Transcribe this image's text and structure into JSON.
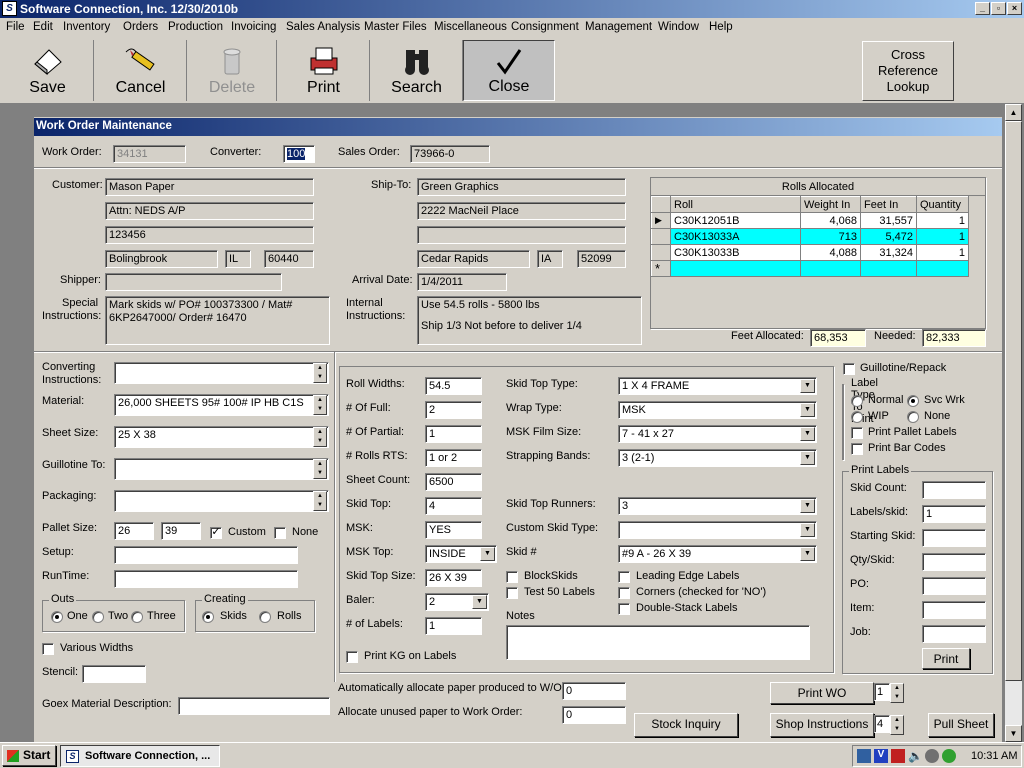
{
  "window": {
    "title": "Software Connection, Inc.    12/30/2010b"
  },
  "menu": [
    "File",
    "Edit",
    "Inventory",
    "Orders",
    "Production",
    "Invoicing",
    "Sales Analysis",
    "Master Files",
    "Miscellaneous",
    "Consignment",
    "Management",
    "Window",
    "Help"
  ],
  "toolbar": {
    "save": "Save",
    "cancel": "Cancel",
    "delete": "Delete",
    "print": "Print",
    "search": "Search",
    "close": "Close",
    "xref_l1": "Cross",
    "xref_l2": "Reference",
    "xref_l3": "Lookup"
  },
  "form": {
    "title": "Work Order Maintenance",
    "work_order_label": "Work Order:",
    "work_order": "34131",
    "converter_label": "Converter:",
    "converter": "100",
    "sales_order_label": "Sales Order:",
    "sales_order": "73966-0",
    "customer_label": "Customer:",
    "customer_name": "Mason Paper",
    "customer_attn": "Attn: NEDS A/P",
    "customer_addr": "123456",
    "customer_city": "Bolingbrook",
    "customer_state": "IL",
    "customer_zip": "60440",
    "shipto_label": "Ship-To:",
    "shipto_name": "Green Graphics",
    "shipto_addr1": "2222 MacNeil Place",
    "shipto_addr2": "",
    "shipto_city": "Cedar Rapids",
    "shipto_state": "IA",
    "shipto_zip": "52099",
    "shipper_label": "Shipper:",
    "shipper": "",
    "arrival_label": "Arrival Date:",
    "arrival": "1/4/2011",
    "special_label_1": "Special",
    "special_label_2": "Instructions:",
    "special": "Mark skids w/ PO# 100373300 / Mat# 6KP2647000/ Order# 16470",
    "internal_label_1": "Internal",
    "internal_label_2": "Instructions:",
    "internal_1": "Use 54.5 rolls -  5800 lbs",
    "internal_2": "Ship 1/3 Not before to deliver 1/4"
  },
  "rolls": {
    "title": "Rolls Allocated",
    "headers": [
      "Roll",
      "Weight In",
      "Feet In",
      "Quantity"
    ],
    "rows": [
      {
        "roll": "C30K12051B",
        "weight": "4,068",
        "feet": "31,557",
        "qty": "1"
      },
      {
        "roll": "C30K13033A",
        "weight": "713",
        "feet": "5,472",
        "qty": "1"
      },
      {
        "roll": "C30K13033B",
        "weight": "4,088",
        "feet": "31,324",
        "qty": "1"
      }
    ],
    "feet_alloc_label": "Feet Allocated:",
    "feet_alloc": "68,353",
    "needed_label": "Needed:",
    "needed": "82,333"
  },
  "left": {
    "conv_instr_l1": "Converting",
    "conv_instr_l2": "Instructions:",
    "conv_instr": "",
    "material_label": "Material:",
    "material": "26,000 SHEETS 95#  100# IP HB C1S",
    "sheet_size_label": "Sheet Size:",
    "sheet_size": "25 X 38",
    "guillotine_label": "Guillotine To:",
    "guillotine": "",
    "packaging_label": "Packaging:",
    "packaging": "",
    "pallet_label": "Pallet Size:",
    "pallet_w": "26",
    "pallet_l": "39",
    "custom_label": "Custom",
    "none_label": "None",
    "setup_label": "Setup:",
    "setup": "",
    "runtime_label": "RunTime:",
    "runtime": "",
    "outs_label": "Outs",
    "outs_one": "One",
    "outs_two": "Two",
    "outs_three": "Three",
    "creating_label": "Creating",
    "creating_skids": "Skids",
    "creating_rolls": "Rolls",
    "various_label": "Various Widths",
    "stencil_label": "Stencil:",
    "stencil": "",
    "goex_label": "Goex Material Description:",
    "goex": ""
  },
  "mid": {
    "roll_widths_label": "Roll Widths:",
    "roll_widths": "54.5",
    "num_full_label": "# Of Full:",
    "num_full": "2",
    "num_partial_label": "# Of Partial:",
    "num_partial": "1",
    "rolls_rts_label": "# Rolls RTS:",
    "rolls_rts": "1 or 2",
    "sheet_count_label": "Sheet Count:",
    "sheet_count": "6500",
    "skid_top_label": "Skid Top:",
    "skid_top": "4",
    "msk_label": "MSK:",
    "msk": "YES",
    "msk_top_label": "MSK Top:",
    "msk_top": "INSIDE",
    "skid_top_size_label": "Skid Top Size:",
    "skid_top_size": "26 X 39",
    "baler_label": "Baler:",
    "baler": "2",
    "num_labels_label": "# of Labels:",
    "num_labels": "1",
    "print_kg_label": "Print KG on Labels",
    "skid_top_type_label": "Skid Top Type:",
    "skid_top_type": "1 X 4 FRAME",
    "wrap_type_label": "Wrap Type:",
    "wrap_type": "MSK",
    "msk_film_label": "MSK Film Size:",
    "msk_film": "7 - 41 x 27",
    "strapping_label": "Strapping Bands:",
    "strapping": "3 (2-1)",
    "runners_label": "Skid Top Runners:",
    "runners": "3",
    "custom_skid_label": "Custom Skid Type:",
    "custom_skid": "",
    "skid_num_label": "Skid #",
    "skid_num": "#9 A - 26 X 39",
    "blockskids_label": "BlockSkids",
    "test50_label": "Test 50 Labels",
    "leading_label": "Leading Edge Labels",
    "corners_label": "Corners (checked for 'NO')",
    "double_label": "Double-Stack Labels",
    "notes_label": "Notes",
    "notes": ""
  },
  "right": {
    "guillotine_repack": "Guillotine/Repack",
    "label_type_label": "Label Type To Print",
    "normal": "Normal",
    "svc_wrk": "Svc Wrk",
    "wip": "WIP",
    "none": "None",
    "pallet_labels": "Print Pallet Labels",
    "bar_codes": "Print Bar Codes",
    "print_labels_label": "Print Labels",
    "skid_count_label": "Skid Count:",
    "skid_count": "",
    "labels_skid_label": "Labels/skid:",
    "labels_skid": "1",
    "starting_skid_label": "Starting Skid:",
    "starting_skid": "",
    "qty_skid_label": "Qty/Skid:",
    "qty_skid": "",
    "po_label": "PO:",
    "po": "",
    "item_label": "Item:",
    "item": "",
    "job_label": "Job:",
    "job": "",
    "print_button": "Print"
  },
  "bottom": {
    "auto_alloc_label": "Automatically allocate paper produced to W/O:",
    "auto_alloc": "0",
    "unused_label": "Allocate unused paper to Work Order:",
    "unused": "0",
    "stock_inquiry": "Stock Inquiry",
    "print_wo": "Print WO",
    "print_wo_count": "1",
    "shop_instr": "Shop Instructions",
    "shop_count": "4",
    "pull_sheet": "Pull Sheet"
  },
  "taskbar": {
    "start": "Start",
    "task": "Software Connection, ...",
    "time": "10:31 AM"
  },
  "colors": {
    "title_start": "#0a246a",
    "selection": "#00ffff",
    "yellow_field": "#ffffe1"
  }
}
